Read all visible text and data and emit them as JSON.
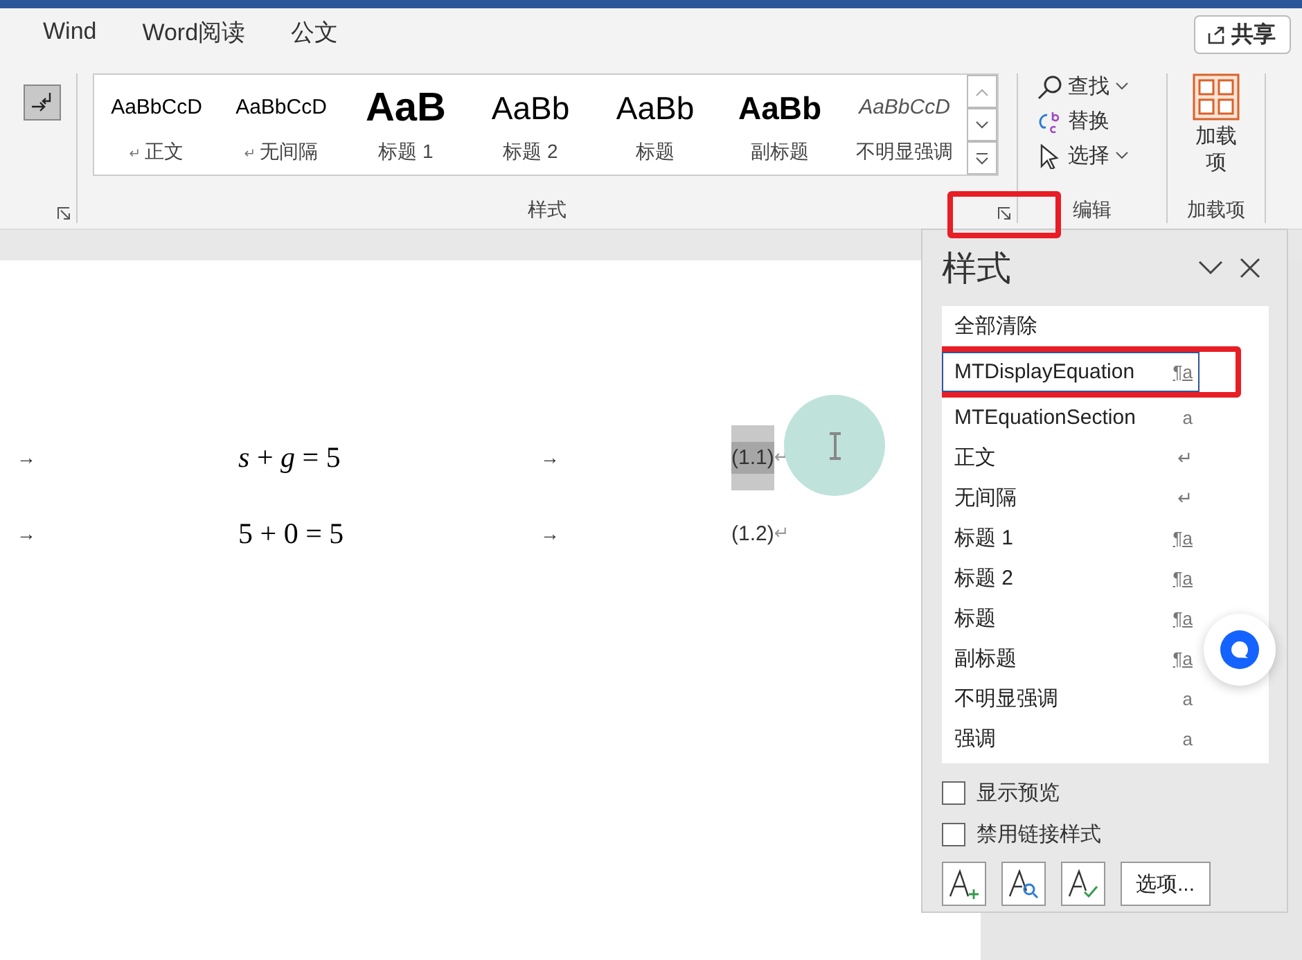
{
  "tabs": [
    {
      "label": "Wind",
      "selected": false
    },
    {
      "label": "Word阅读",
      "selected": false
    },
    {
      "label": "公文",
      "selected": false
    }
  ],
  "share_button": {
    "label": "共享"
  },
  "style_gallery": {
    "group_label": "样式",
    "launcher_highlighted": true,
    "items": [
      {
        "preview": "AaBbCcD",
        "name": "正文",
        "mark": "↵",
        "kind": "normal"
      },
      {
        "preview": "AaBbCcD",
        "name": "无间隔",
        "mark": "↵",
        "kind": "normal"
      },
      {
        "preview": "AaB",
        "name": "标题 1",
        "kind": "heading1"
      },
      {
        "preview": "AaBb",
        "name": "标题 2",
        "kind": "heading2"
      },
      {
        "preview": "AaBb",
        "name": "标题",
        "kind": "title"
      },
      {
        "preview": "AaBb",
        "name": "副标题",
        "kind": "subtitle"
      },
      {
        "preview": "AaBbCcD",
        "name": "不明显强调",
        "kind": "emphasis"
      }
    ]
  },
  "editing": {
    "group_label": "编辑",
    "items": [
      {
        "label": "查找",
        "kind": "find",
        "dropdown": true
      },
      {
        "label": "替换",
        "kind": "replace",
        "dropdown": false
      },
      {
        "label": "选择",
        "kind": "select",
        "dropdown": true
      }
    ]
  },
  "addins": {
    "button": "加载项",
    "group_label": "加载项"
  },
  "document": {
    "lines": [
      {
        "tab_before": "→",
        "formula": "*s* + *g* = 5",
        "tab_after": "→",
        "number": "(1.1)",
        "end_mark": "↵",
        "selected": true
      },
      {
        "tab_before": "→",
        "formula": "5 + 0 = 5",
        "tab_after": "→",
        "number": "(1.2)",
        "end_mark": "↵",
        "selected": false
      }
    ]
  },
  "styles_pane": {
    "title": "样式",
    "items": [
      {
        "name": "全部清除",
        "selected": false,
        "highlighted": false
      },
      {
        "name": "MTDisplayEquation",
        "type_mark": "¶a",
        "kind": "linked",
        "selected": true,
        "highlighted": true
      },
      {
        "name": "MTEquationSection",
        "type_mark": "a",
        "kind": "character",
        "selected": false
      },
      {
        "name": "正文",
        "type_mark": "↵",
        "kind": "paragraph",
        "selected": false
      },
      {
        "name": "无间隔",
        "type_mark": "↵",
        "kind": "paragraph",
        "selected": false
      },
      {
        "name": "标题 1",
        "type_mark": "¶a",
        "kind": "linked",
        "selected": false
      },
      {
        "name": "标题 2",
        "type_mark": "¶a",
        "kind": "linked",
        "selected": false
      },
      {
        "name": "标题",
        "type_mark": "¶a",
        "kind": "linked",
        "selected": false
      },
      {
        "name": "副标题",
        "type_mark": "¶a",
        "kind": "linked",
        "selected": false
      },
      {
        "name": "不明显强调",
        "type_mark": "a",
        "kind": "character",
        "selected": false
      },
      {
        "name": "强调",
        "type_mark": "a",
        "kind": "character",
        "selected": false
      }
    ],
    "options": [
      {
        "label": "显示预览",
        "checked": false
      },
      {
        "label": "禁用链接样式",
        "checked": false
      }
    ],
    "options_button": "选项..."
  }
}
